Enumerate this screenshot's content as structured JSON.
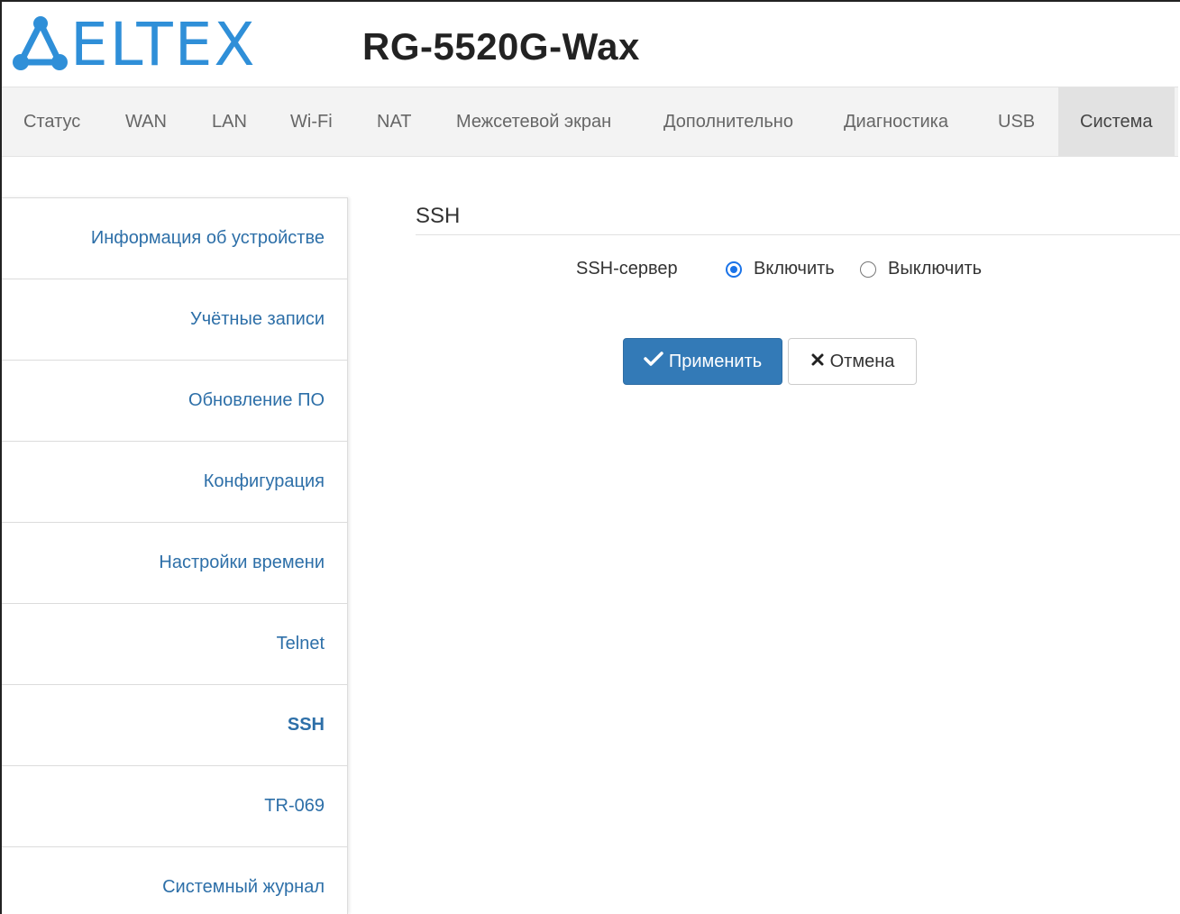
{
  "header": {
    "logo_text": "ELTEX",
    "model": "RG-5520G-Wax"
  },
  "topnav": {
    "items": [
      {
        "label": "Статус"
      },
      {
        "label": "WAN"
      },
      {
        "label": "LAN"
      },
      {
        "label": "Wi-Fi"
      },
      {
        "label": "NAT"
      },
      {
        "label": "Межсетевой экран"
      },
      {
        "label": "Дополнительно"
      },
      {
        "label": "Диагностика"
      },
      {
        "label": "USB"
      },
      {
        "label": "Система"
      }
    ],
    "active": "Система"
  },
  "sidebar": {
    "items": [
      {
        "label": "Информация об устройстве"
      },
      {
        "label": "Учётные записи"
      },
      {
        "label": "Обновление ПО"
      },
      {
        "label": "Конфигурация"
      },
      {
        "label": "Настройки времени"
      },
      {
        "label": "Telnet"
      },
      {
        "label": "SSH"
      },
      {
        "label": "TR-069"
      },
      {
        "label": "Системный журнал"
      }
    ],
    "active": "SSH"
  },
  "main": {
    "title": "SSH",
    "ssh_server": {
      "label": "SSH-сервер",
      "options": [
        {
          "label": "Включить",
          "checked": true
        },
        {
          "label": "Выключить",
          "checked": false
        }
      ]
    },
    "apply_label": "Применить",
    "cancel_label": "Отмена"
  },
  "colors": {
    "brand": "#2f8fd8",
    "link": "#2d6fa8",
    "primary_button": "#337ab7",
    "radio_checked": "#1a73e8"
  },
  "icons": {
    "logo": "eltex-logo-icon",
    "apply": "check-icon",
    "cancel": "close-icon"
  }
}
